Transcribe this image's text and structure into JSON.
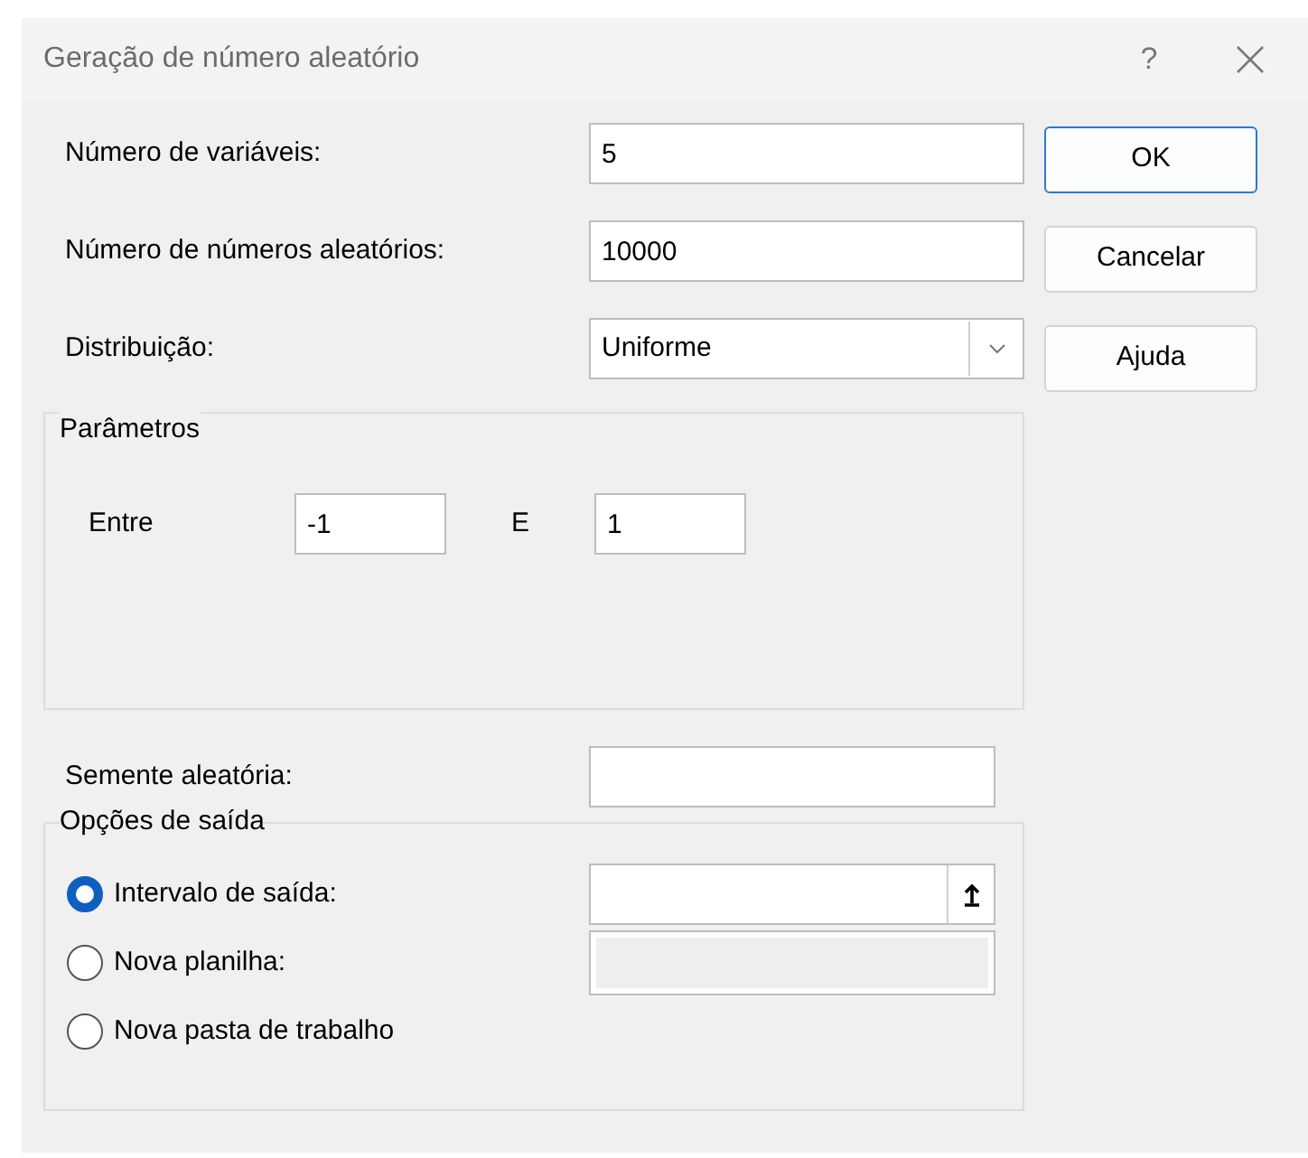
{
  "window": {
    "title": "Geração de número aleatório",
    "help": "?"
  },
  "fields": [
    {
      "label": "Número de variáveis:",
      "value": "5"
    },
    {
      "label": "Número de números aleatórios:",
      "value": "10000"
    }
  ],
  "distribution": {
    "label": "Distribuição:",
    "value": "Uniforme"
  },
  "buttons": [
    {
      "label": "OK",
      "default": true
    },
    {
      "label": "Cancelar",
      "default": false
    },
    {
      "label": "Ajuda",
      "default": false
    }
  ],
  "parameters": {
    "title": "Parâmetros",
    "from_label": "Entre",
    "from_value": "-1",
    "to_label": "E",
    "to_value": "1"
  },
  "seed": {
    "label": "Semente aleatória:"
  },
  "output": {
    "title": "Opções de saída",
    "options": [
      {
        "label": "Intervalo de saída:",
        "selected": true,
        "kind": "range"
      },
      {
        "label": "Nova planilha:",
        "selected": false,
        "kind": "disabled"
      },
      {
        "label": "Nova pasta de trabalho",
        "selected": false,
        "kind": "plain"
      }
    ]
  }
}
